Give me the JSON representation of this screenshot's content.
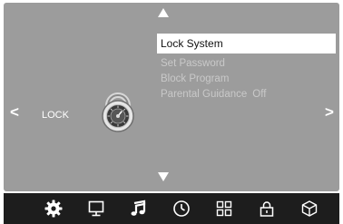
{
  "navigation": {
    "up_arrow": "▲",
    "down_arrow": "▼",
    "left_arrow": "<",
    "right_arrow": ">"
  },
  "section": {
    "label": "LOCK",
    "icon": "combination-padlock-icon"
  },
  "menu": {
    "items": [
      {
        "label": "Lock System",
        "selected": true
      },
      {
        "label": "Set Password",
        "selected": false
      },
      {
        "label": "Block Program",
        "selected": false
      },
      {
        "label": "Parental Guidance",
        "value": "Off",
        "selected": false
      }
    ]
  },
  "tabbar": {
    "tabs": [
      {
        "icon": "gear-icon",
        "active": true
      },
      {
        "icon": "monitor-icon",
        "active": false
      },
      {
        "icon": "music-note-icon",
        "active": false
      },
      {
        "icon": "clock-icon",
        "active": false
      },
      {
        "icon": "grid-icon",
        "active": false
      },
      {
        "icon": "lock-icon",
        "active": false
      },
      {
        "icon": "cube-icon",
        "active": false
      }
    ]
  },
  "colors": {
    "panel_background": "#9c9c9c",
    "tabbar_background": "#1d1d1d",
    "selected_item_background": "#ffffff",
    "inactive_text": "#c9c9c9",
    "icon_color": "#ffffff"
  }
}
